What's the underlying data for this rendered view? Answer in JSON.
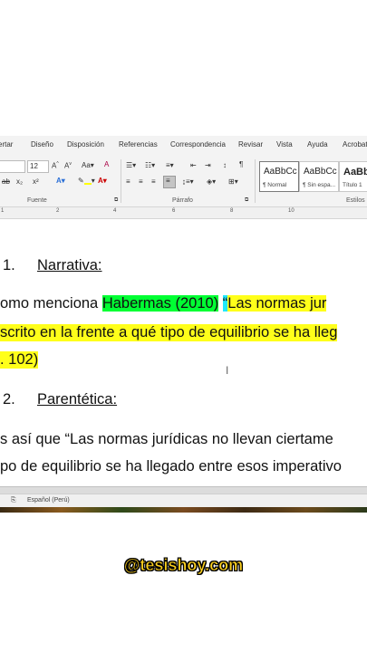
{
  "ribbon_tabs": [
    "ertar",
    "Diseño",
    "Disposición",
    "Referencias",
    "Correspondencia",
    "Revisar",
    "Vista",
    "Ayuda",
    "Acrobat"
  ],
  "ribbon": {
    "font_size": "12",
    "group_labels": {
      "font": "Fuente",
      "paragraph": "Párrafo",
      "styles": "Estilos"
    },
    "styles": [
      {
        "sample": "AaBbCc",
        "name": "¶ Normal"
      },
      {
        "sample": "AaBbCc",
        "name": "¶ Sin espa..."
      },
      {
        "sample": "AaBb",
        "name": "Título 1"
      }
    ]
  },
  "ruler": {
    "ticks": [
      "1",
      "2",
      "4",
      "6",
      "8",
      "10"
    ]
  },
  "document": {
    "item1_number": "1.",
    "item1_title": "Narrativa:",
    "line1_prefix": "omo menciona ",
    "line1_author": "Habermas (2010)",
    "line1_quote_mark": "“",
    "line1_quote_start": "Las normas jur",
    "line2": "scrito en la frente a qué tipo de equilibrio se ha lleg",
    "line3": ". 102)",
    "item2_number": "2.",
    "item2_title": "Parentética:",
    "line4": "s así que “Las normas jurídicas no llevan ciertame",
    "line5": "po de equilibrio se ha llegado entre esos imperativo"
  },
  "status_bar": {
    "language": "Español (Perú)"
  },
  "watermark": "@tesishoy.com",
  "colors": {
    "green_highlight": "#00ff33",
    "yellow_highlight": "#ffff1a",
    "cyan_highlight": "#20e8ff",
    "watermark": "#ffd21f"
  }
}
